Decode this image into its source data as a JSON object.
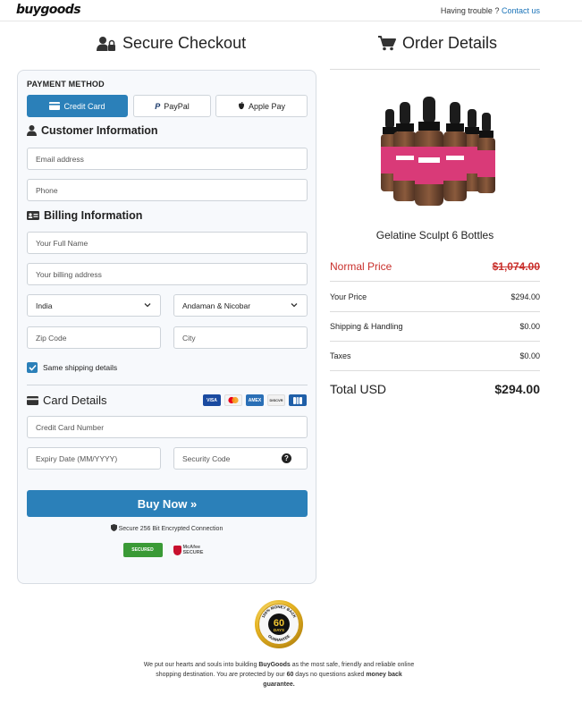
{
  "brand": {
    "logo": "buygoods"
  },
  "header": {
    "help_text": "Having trouble ?",
    "help_link": "Contact us"
  },
  "checkout": {
    "title": "Secure Checkout",
    "payment_method_label": "PAYMENT METHOD",
    "payment_methods": [
      {
        "label": "Credit Card",
        "active": true
      },
      {
        "label": "PayPal",
        "active": false
      },
      {
        "label": "Apple Pay",
        "active": false
      }
    ],
    "customer_title": "Customer Information",
    "email_placeholder": "Email address",
    "phone_placeholder": "Phone",
    "billing_title": "Billing Information",
    "fullname_placeholder": "Your Full Name",
    "address_placeholder": "Your billing address",
    "country_value": "India",
    "state_value": "Andaman & Nicobar",
    "zip_placeholder": "Zip Code",
    "city_placeholder": "City",
    "same_shipping_label": "Same shipping details",
    "same_shipping_checked": true,
    "card_title": "Card Details",
    "card_brands": [
      "visa-icon",
      "mastercard-icon",
      "amex-icon",
      "discover-icon",
      "jcb-icon"
    ],
    "card_number_placeholder": "Credit Card Number",
    "expiry_placeholder": "Expiry Date (MM/YYYY)",
    "security_placeholder": "Security Code",
    "buy_button": "Buy Now »",
    "secure_note": "Secure 256 Bit Encrypted Connection",
    "trust_badges": [
      "SECURED",
      "McAfee SECURE"
    ]
  },
  "order": {
    "title": "Order Details",
    "product_name": "Gelatine Sculpt 6 Bottles",
    "normal_price_label": "Normal Price",
    "normal_price_value": "$1,074.00",
    "your_price_label": "Your Price",
    "your_price_value": "$294.00",
    "shipping_label": "Shipping & Handling",
    "shipping_value": "$0.00",
    "taxes_label": "Taxes",
    "taxes_value": "$0.00",
    "total_label": "Total USD",
    "total_value": "$294.00"
  },
  "guarantee": {
    "seal_top": "100% MONEY BACK",
    "seal_days": "60",
    "seal_unit": "DAYS",
    "seal_bottom": "GUARANTEE",
    "footer_1": "We put our hearts and souls into building ",
    "footer_brand": "BuyGoods",
    "footer_2": " as the most safe, friendly and reliable online shopping destination. You are protected by our ",
    "footer_days": "60",
    "footer_3": " days no questions asked ",
    "footer_guarantee": "money back guarantee."
  },
  "colors": {
    "accent": "#2b80b9",
    "price_red": "#c9302c"
  }
}
